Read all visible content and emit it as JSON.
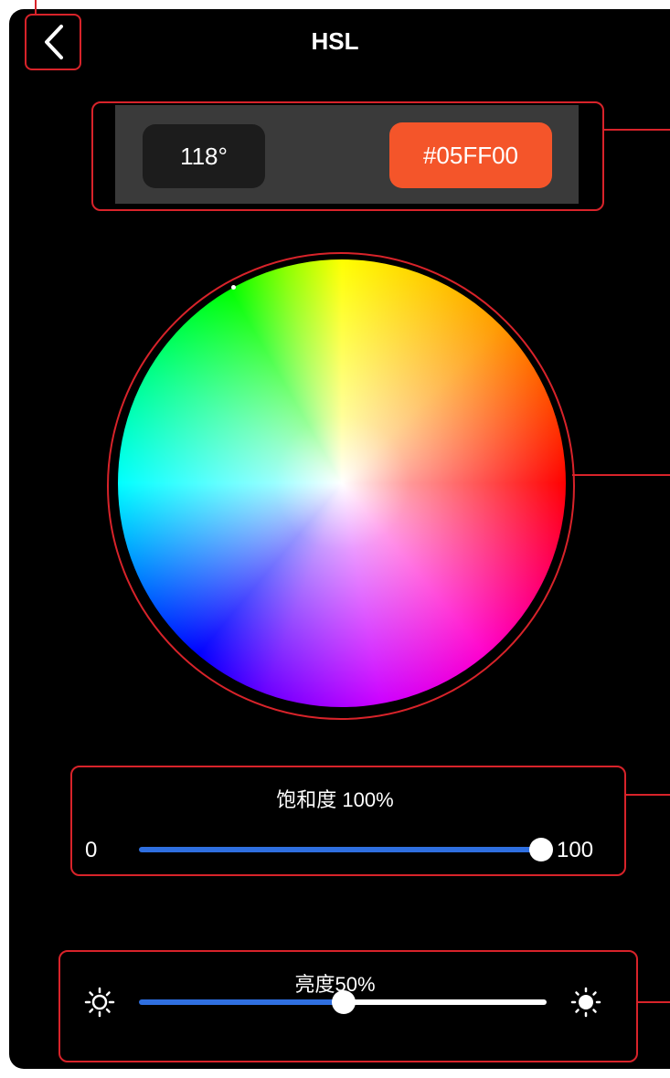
{
  "header": {
    "title": "HSL",
    "back_icon": "chevron-left-icon"
  },
  "color_values": {
    "hue": "118°",
    "hex": "#05FF00",
    "hex_button_color": "#F4552A"
  },
  "color_wheel": {
    "selected_hue_degrees": 118
  },
  "saturation": {
    "label": "饱和度 100%",
    "min_label": "0",
    "max_label": "100",
    "value": 100,
    "track_color": "#2F6FE0"
  },
  "brightness": {
    "label": "亮度50%",
    "value": 50,
    "min_icon": "sun-outline-icon",
    "max_icon": "sun-filled-icon",
    "track_color": "#2F6FE0"
  },
  "annotation_color": "#D8232A"
}
